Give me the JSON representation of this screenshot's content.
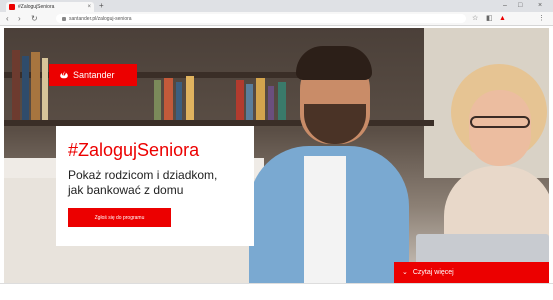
{
  "browser": {
    "tab_title": "#ZalogujSeniora",
    "tab_close": "×",
    "new_tab": "+",
    "url": "santander.pl/zaloguj-seniora",
    "back": "‹",
    "forward": "›",
    "reload": "↻",
    "min": "–",
    "max": "□",
    "close": "×"
  },
  "page": {
    "brand": "Santander",
    "hashtag": "#ZalogujSeniora",
    "headline_line1": "Pokaż rodzicom i dziadkom,",
    "headline_line2": "jak bankować z domu",
    "cta_label": "Zgłoś się do programu",
    "read_more": "Czytaj więcej"
  },
  "colors": {
    "brand_red": "#ec0000"
  }
}
